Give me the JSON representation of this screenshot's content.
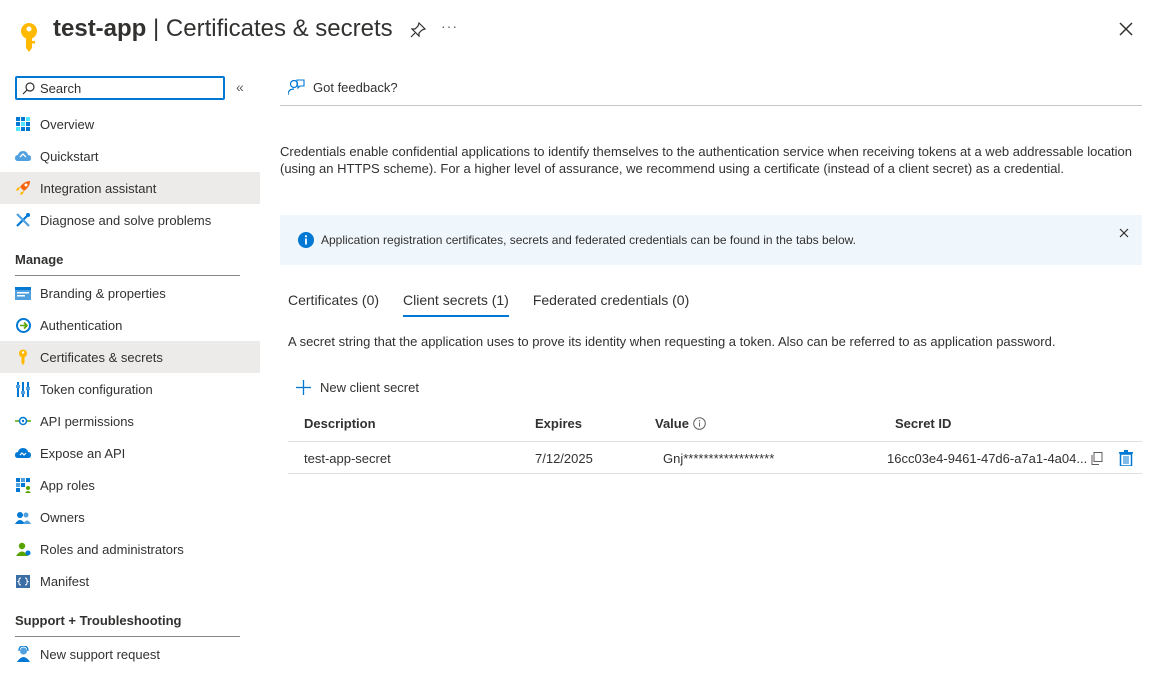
{
  "header": {
    "app_name": "test-app",
    "separator": " | ",
    "page_title": "Certificates & secrets",
    "more_label": "···"
  },
  "sidebar": {
    "search_placeholder": "Search",
    "collapse_label": "«",
    "top_items": [
      {
        "label": "Overview",
        "icon": "overview-icon"
      },
      {
        "label": "Quickstart",
        "icon": "quickstart-icon"
      },
      {
        "label": "Integration assistant",
        "icon": "rocket-icon"
      },
      {
        "label": "Diagnose and solve problems",
        "icon": "wrench-icon"
      }
    ],
    "manage_heading": "Manage",
    "manage_items": [
      {
        "label": "Branding & properties",
        "icon": "branding-icon"
      },
      {
        "label": "Authentication",
        "icon": "authentication-icon"
      },
      {
        "label": "Certificates & secrets",
        "icon": "key-icon",
        "active": true
      },
      {
        "label": "Token configuration",
        "icon": "token-icon"
      },
      {
        "label": "API permissions",
        "icon": "api-permissions-icon"
      },
      {
        "label": "Expose an API",
        "icon": "cloud-icon"
      },
      {
        "label": "App roles",
        "icon": "app-roles-icon"
      },
      {
        "label": "Owners",
        "icon": "owners-icon"
      },
      {
        "label": "Roles and administrators",
        "icon": "roles-icon"
      },
      {
        "label": "Manifest",
        "icon": "manifest-icon"
      }
    ],
    "support_heading": "Support + Troubleshooting",
    "support_items": [
      {
        "label": "New support request",
        "icon": "support-icon"
      }
    ]
  },
  "main": {
    "feedback_label": "Got feedback?",
    "description": "Credentials enable confidential applications to identify themselves to the authentication service when receiving tokens at a web addressable location (using an HTTPS scheme). For a higher level of assurance, we recommend using a certificate (instead of a client secret) as a credential.",
    "info_message": "Application registration certificates, secrets and federated credentials can be found in the tabs below.",
    "tabs": [
      {
        "label": "Certificates (0)"
      },
      {
        "label": "Client secrets (1)",
        "active": true
      },
      {
        "label": "Federated credentials (0)"
      }
    ],
    "tab_description": "A secret string that the application uses to prove its identity when requesting a token. Also can be referred to as application password.",
    "new_secret_label": "New client secret",
    "table": {
      "columns": [
        "Description",
        "Expires",
        "Value",
        "Secret ID"
      ],
      "rows": [
        {
          "description": "test-app-secret",
          "expires": "7/12/2025",
          "value": "Gnj******************",
          "secret_id": "16cc03e4-9461-47d6-a7a1-4a04..."
        }
      ]
    }
  },
  "colors": {
    "accent": "#0078d4",
    "active_bg": "#edebe9",
    "info_bg": "#eff6fc",
    "key_yellow": "#ffb900"
  }
}
